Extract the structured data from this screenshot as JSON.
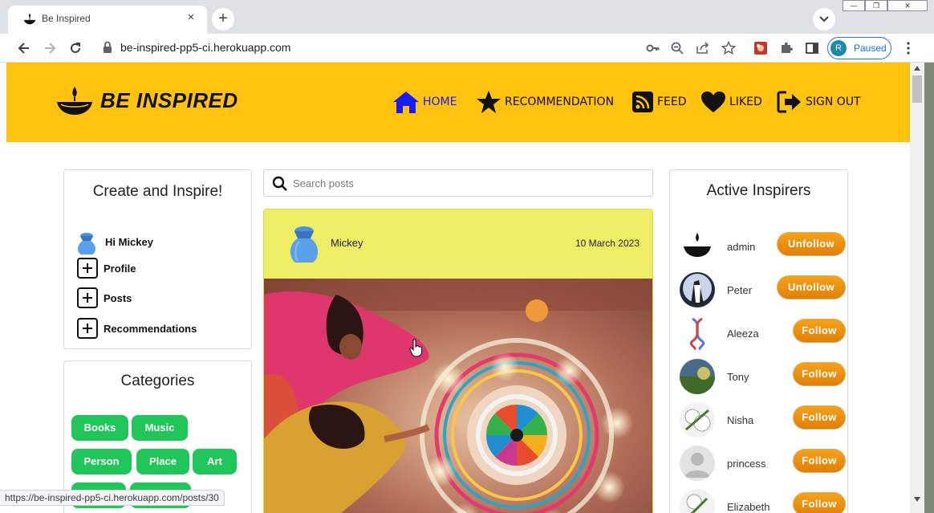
{
  "browser": {
    "tab_title": "Be Inspired",
    "tab_close": "×",
    "new_tab": "+",
    "url": "be-inspired-pp5-ci.herokuapp.com",
    "profile_initial": "R",
    "profile_status": "Paused",
    "window_min": "—",
    "window_max": "❐",
    "window_close": "✕",
    "status_url": "https://be-inspired-pp5-ci.herokuapp.com/posts/30"
  },
  "header": {
    "brand": "BE INSPIRED",
    "bg_color": "#ffc20e",
    "nav": [
      {
        "label": "HOME",
        "icon": "home-icon",
        "active": true
      },
      {
        "label": "RECOMMENDATION",
        "icon": "star-icon"
      },
      {
        "label": "FEED",
        "icon": "rss-icon"
      },
      {
        "label": "LIKED",
        "icon": "heart-icon"
      },
      {
        "label": "SIGN OUT",
        "icon": "sign-out-icon"
      }
    ]
  },
  "create": {
    "title": "Create and Inspire!",
    "greeting": "Hi Mickey",
    "links": [
      "Profile",
      "Posts",
      "Recommendations"
    ]
  },
  "categories": {
    "title": "Categories",
    "items": [
      "Books",
      "Music",
      "Person",
      "Place",
      "Art"
    ],
    "chip_color": "#20c659"
  },
  "search": {
    "placeholder": "Search posts"
  },
  "post": {
    "author": "Mickey",
    "date": "10 March 2023",
    "header_color": "#eded66"
  },
  "inspirers": {
    "title": "Active Inspirers",
    "button_color": "#f28c0f",
    "items": [
      {
        "name": "admin",
        "button": "Unfollow"
      },
      {
        "name": "Peter",
        "button": "Unfollow"
      },
      {
        "name": "Aleeza",
        "button": "Follow"
      },
      {
        "name": "Tony",
        "button": "Follow"
      },
      {
        "name": "Nisha",
        "button": "Follow"
      },
      {
        "name": "princess",
        "button": "Follow"
      },
      {
        "name": "Elizabeth",
        "button": "Follow"
      }
    ]
  }
}
